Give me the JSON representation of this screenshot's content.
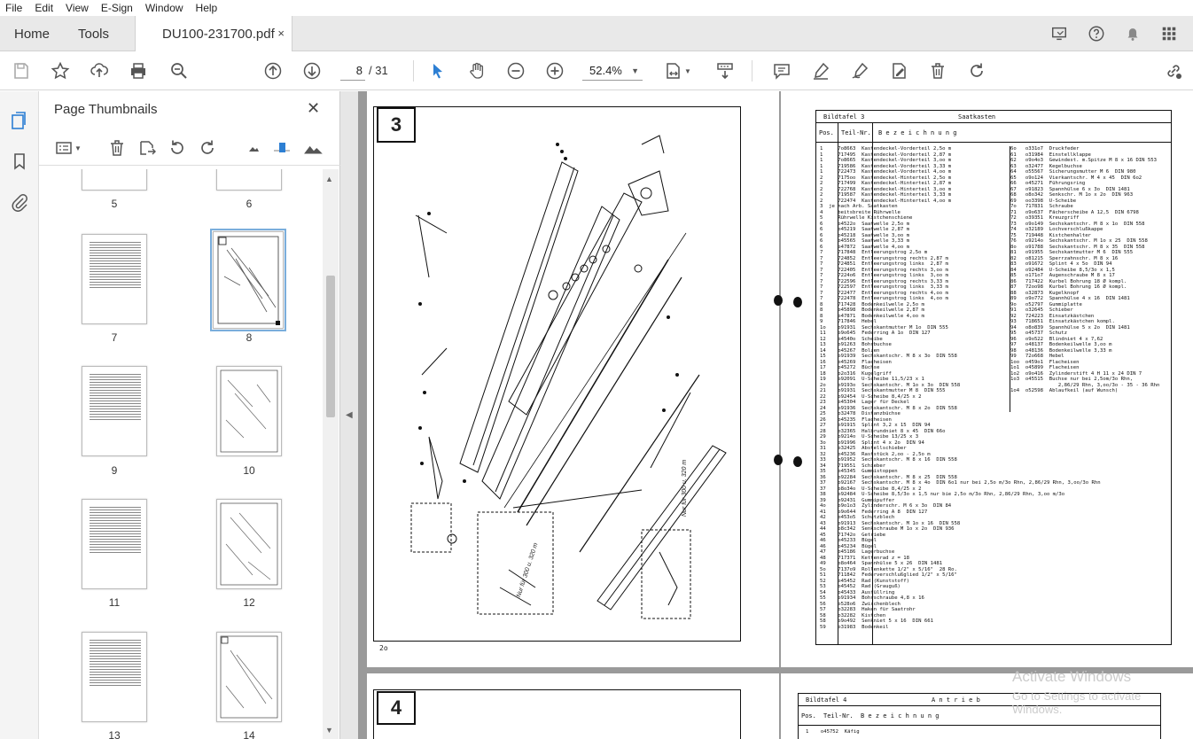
{
  "menu": [
    "File",
    "Edit",
    "View",
    "E-Sign",
    "Window",
    "Help"
  ],
  "tabs": {
    "home": "Home",
    "tools": "Tools",
    "document": "DU100-231700.pdf",
    "close_glyph": "×"
  },
  "toolbar": {
    "current_page": "8",
    "total_pages": "/ 31",
    "zoom": "52.4%"
  },
  "icons": {
    "save": "save-icon",
    "bookmark_star": "star-icon",
    "upload": "upload-icon",
    "print": "print-icon",
    "zoom_search": "zoom-out-search-icon",
    "page_up": "prev-page-icon",
    "page_down": "next-page-icon",
    "select": "cursor-icon",
    "hand": "hand-icon",
    "zoom_out": "zoom-out-icon",
    "zoom_in": "zoom-in-icon",
    "fit": "fit-page-icon",
    "scroll_mode": "scroll-mode-icon",
    "comment": "comment-icon",
    "highlight": "highlight-icon",
    "sign": "sign-icon",
    "edit": "edit-icon",
    "delete": "delete-icon",
    "rotate": "rotate-icon",
    "share": "share-link-icon"
  },
  "panel": {
    "title": "Page Thumbnails",
    "close_glyph": "✕",
    "thumbnails": [
      {
        "label": "5"
      },
      {
        "label": "6"
      },
      {
        "label": "7"
      },
      {
        "label": "8"
      },
      {
        "label": "9"
      },
      {
        "label": "10"
      },
      {
        "label": "11"
      },
      {
        "label": "12"
      },
      {
        "label": "13"
      },
      {
        "label": "14"
      }
    ]
  },
  "page_left": {
    "plate_number": "3",
    "footer_number": "2o",
    "side_note_1": "Nur für 300 u. 320 m",
    "side_note_2": "Nur für 300 u. 320 m"
  },
  "page_right": {
    "header_left": "Bildtafel  3",
    "header_title": "Saatkasten",
    "col_pos": "Pos.",
    "col_part": "Teil-Nr.",
    "col_desc": "B e z e i c h n u n g",
    "rows_left": "1     7o8663  Kastendeckel-Vorderteil 2,5o m\n1     717495  Kastendeckel-Vorderteil 2,87 m\n1     7o8665  Kastendeckel-Vorderteil 3,oo m\n1     719586  Kastendeckel-Vorderteil 3,33 m\n1     722473  Kastendeckel-Vorderteil 4,oo m\n2     7175oo  Kastendeckel-Hinterteil 2,5o m\n2     717499  Kastendeckel-Hinterteil 2,87 m\n2     722768  Kastendeckel-Hinterteil 3,oo m\n2     719587  Kastendeckel-Hinterteil 3,33 m\n2     722474  Kastendeckel-Hinterteil 4,oo m\n3  je nach Arb. Saatkasten\n4     beitsbreite Rührwelle\n5     Rührwelle Kistchenschiene\n6     o4522o  Saatwelle 2,5o m\n6     o45219  Saatwelle 2,87 m\n6     o45218  Saatwelle 3,oo m\n6     o45565  Saatwelle 3,33 m\n6     o47872  Saatwelle 4,oo m\n7     717848  Entleerungstrog 2,5o m\n7     724852  Entleerungstrog rechts 2,87 m\n7     724851  Entleerungstrog links  2,87 m\n7     722405  Entleerungstrog rechts 3,oo m\n7     7224o6  Entleerungstrog links  3,oo m\n7     722596  Entleerungstrog rechts 3,33 m\n7     722597  Entleerungstrog links  3,33 m\n7     722477  Entleerungstrog rechts 4,oo m\n7     722478  Entleerungstrog links  4,oo m\n8     717428  Bodenkeilwelle 2,5o m\n8     o45898  Bodenkeilwelle 2,87 m\n8     o47871  Bodenkeilwelle 4,oo m\n9     717846  Hebel\n1o    o91931  Sechskantmutter M 1o  DIN 555\n11    o9o645  Federring A 1o  DIN 127\n12    o4540o  Scheibe\n13    o91263  Bohrbuchse\n14    o45267  Bolzen\n15    o91939  Sechskantschr. M 8 x 3o  DIN 558\n16    o45269  Flacheisen\n17    o45272  Büchse\n18    o2o316  Kugelgriff\n19    o92091  U-Scheibe 11,5/23 x 1\n2o    o9193o  Sechskantschr. M 1o x 3o  DIN 558\n21    o91931  Sechskantmutter M 8  DIN 555\n22    o92454  U-Scheibe 8,4/25 x 2\n23    o45304  Lager für Deckel\n24    o91936  Sechskantschr. M 8 x 2o  DIN 558\n25    o32478  Distanzbüchse\n26    o45235  Flacheisen\n27    o91915  Splint 3,2 x 15  DIN 94\n28    o32365  Halbrundniet 8 x 45  DIN 66o\n29    o9214o  U-Scheibe 13/25 x 3\n3o    o91996  Splint 4 x 2o  DIN 94\n31    o32425  Abstellschieber\n32    o45236  Raststück 2,oo - 2,5o m\n33    o91952  Sechskantschr. M 8 x 16  DIN 558\n34    719551  Schieber\n35    o45345  Gummistoppen\n36    o92284  Sechskantschr. M 8 x 25  DIN 558\n37    o92167  Sechskantschr. M 8 x 4o  DIN 6o1 nur bei 2,5o m/3o Rhn, 2,86/29 Rhn, 3,oo/3o Rhn\n37    o8o34o  U-Scheibe 8,4/25 x 2\n38    o92484  U-Scheibe 8,5/3o x 1,5 nur bie 2,5o m/3o Rhn, 2,86/29 Rhn, 3,oo m/3o\n39    o92431  Gummipuffer\n4o    o9o1o3  Zylinderschr. M 6 x 3o  DIN 84\n41    o9o644  Federring A 8  DIN 127\n42    o453o5  Schutzblech\n43    o91913  Sechskantschr. M 1o x 16  DIN 558\n44    o8c342  Senkschraube M 1o x 2o  DIN 936\n45    71742o  Getriebe\n46    o45233  Bügel\n46    o45234  Bügel\n47    o45186  Lagerbuchse\n48    717371  Kettenrad z = 18\n49    o8o464  Spannhülse 5 x 26  DIN 1481\n5o    7137o9  Rollenkette 1/2\" x 5/16\"  28 Ro.\n51    711842  Federverschlußglied 1/2\" x 5/16\"\n52    o45452  Rad (Kunststoff)\n53    o45452  Rad (Grauguß)\n54    o45433  Ausfüllring\n55    o91934  Bohrschraube 4,8 x 16\n56    o528o6  Zwischenblech\n57    o32283  Haken für Saatrohr\n58    o32282  Kistchen\n58    o9o492  Senkniet 5 x 16  DIN 661\n59    o31983  Bodenkeil",
    "rows_right": "6o   o331o7  Druckfeder\n61   o31984  Einstellklappe\n62   o9o4o3  Gewindest. m.Spitze M 8 x 16 DIN 553\n63   o32477  Kegelbuchse\n64   o55567  Sicherungsmutter M 6  DIN 980\n65   o9o124  Vierkantschr. M 4 x 45  DIN 6o2\n66   o45271  Führungsring\n67   o91823  Spannhülse 6 x 3o  DIN 1481\n68   o8o342  Senkschr. M 1o x 2o  DIN 963\n69   oo3398  U-Scheibe\n7o   717831  Schraube\n71   o9o637  Fächerscheibe A 12,5  DIN 6798\n72   o39351  Kreuzgriff\n73   o9o149  Sechskantschr. M 8 x 1o  DIN 558\n74   o32189  Lochverschlußkappe\n75   719448  Kistchenhalter\n76   o9214o  Sechskantschr. M 1o x 25  DIN 558\n8o   o91788  Sechskantschr. M 8 x 35  DIN 558\n81   o91955  Sechskantmutter M 6  DIN 555\n82   o81215  Sperrzahnschr. M 8 x 16\n83   o91672  Splint 4 x 5o  DIN 94\n84   o92484  U-Scheibe 8,5/3o x 1,5\n85   o171o7  Augenschraube M 8 x 17\n86   717422  Kurbel Bohrung 18 Ø kompl.\n87   72oo98  Kurbel Bohrung 16 Ø kompl.\n88   o32873  Kugelknopf\n89   o9o772  Spannhülse 4 x 16  DIN 1481\n9o   o52797  Gummiplatte\n91   o32645  Schieber\n92   724223  Einsatzkästchen\n93   718651  Einsatzkästchen kompl.\n94   o8o839  Spannhülse 5 x 2o  DIN 1481\n95   o45737  Schutz\n96   o9o522  Blindniet 4 x 7,62\n97   o48137  Bodenkeilwelle 3,oo m\n98   o48136  Bodenkeilwelle 3,33 m\n99   72o668  Hebel\n1oo  o459o1  Flacheisen\n1o1  o45899  Flacheisen\n1o2  o9o416  Zylinderstift 4 H 11 x 24 DIN 7\n1o3  o45515  Buchse nur bei 2,5om/3o Rhn,\n                2,86/29 Rhn, 3,oo/3o - 35 - 36 Rhn\n1o4  o52598  Ablaufkeil (auf Wunsch)",
    "next_header_left": "Bildtafel 4",
    "next_header_title": "A n t r i e b",
    "next_row": "1    o45752  Käfig"
  },
  "next_page_left": {
    "plate_number": "4"
  },
  "watermark": {
    "line1": "Activate Windows",
    "line2": "Go to Settings to activate Windows."
  }
}
